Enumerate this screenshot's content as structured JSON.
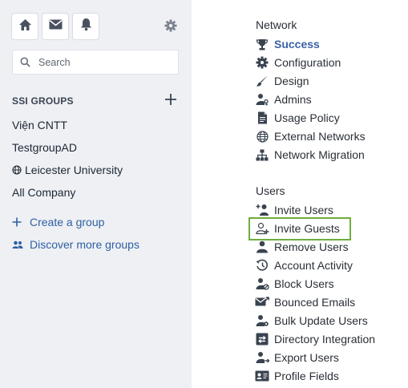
{
  "sidebar": {
    "top_icons": [
      "home-icon",
      "envelope-icon",
      "bell-icon"
    ],
    "settings_icon": "gear-icon",
    "search": {
      "placeholder": "Search"
    },
    "groups_heading": "SSI GROUPS",
    "groups": [
      {
        "label": "Viện CNTT"
      },
      {
        "label": "TestgroupAD"
      },
      {
        "label": "Leicester University",
        "icon": "globe-icon"
      },
      {
        "label": "All Company"
      }
    ],
    "actions": [
      {
        "label": "Create a group",
        "icon": "plus-icon"
      },
      {
        "label": "Discover more groups",
        "icon": "people-icon"
      }
    ]
  },
  "network": {
    "title": "Network",
    "items": [
      {
        "label": "Success",
        "icon": "trophy-icon",
        "active": true
      },
      {
        "label": "Configuration",
        "icon": "cog-icon"
      },
      {
        "label": "Design",
        "icon": "brush-icon"
      },
      {
        "label": "Admins",
        "icon": "user-key-icon"
      },
      {
        "label": "Usage Policy",
        "icon": "document-icon"
      },
      {
        "label": "External Networks",
        "icon": "globe-icon"
      },
      {
        "label": "Network Migration",
        "icon": "hierarchy-icon"
      }
    ]
  },
  "users": {
    "title": "Users",
    "items": [
      {
        "label": "Invite Users",
        "icon": "user-plus-icon"
      },
      {
        "label": "Invite Guests",
        "icon": "guest-plus-icon",
        "highlighted": true
      },
      {
        "label": "Remove Users",
        "icon": "user-remove-icon"
      },
      {
        "label": "Account Activity",
        "icon": "history-icon"
      },
      {
        "label": "Block Users",
        "icon": "user-block-icon"
      },
      {
        "label": "Bounced Emails",
        "icon": "mail-bounce-icon"
      },
      {
        "label": "Bulk Update Users",
        "icon": "user-gear-icon"
      },
      {
        "label": "Directory Integration",
        "icon": "sync-icon"
      },
      {
        "label": "Export Users",
        "icon": "user-export-icon"
      },
      {
        "label": "Profile Fields",
        "icon": "id-card-icon"
      }
    ]
  },
  "colors": {
    "sidebar_bg": "#eef0f4",
    "link": "#2e5fa3",
    "active": "#3a62a7",
    "highlight_border": "#6fad3f"
  }
}
